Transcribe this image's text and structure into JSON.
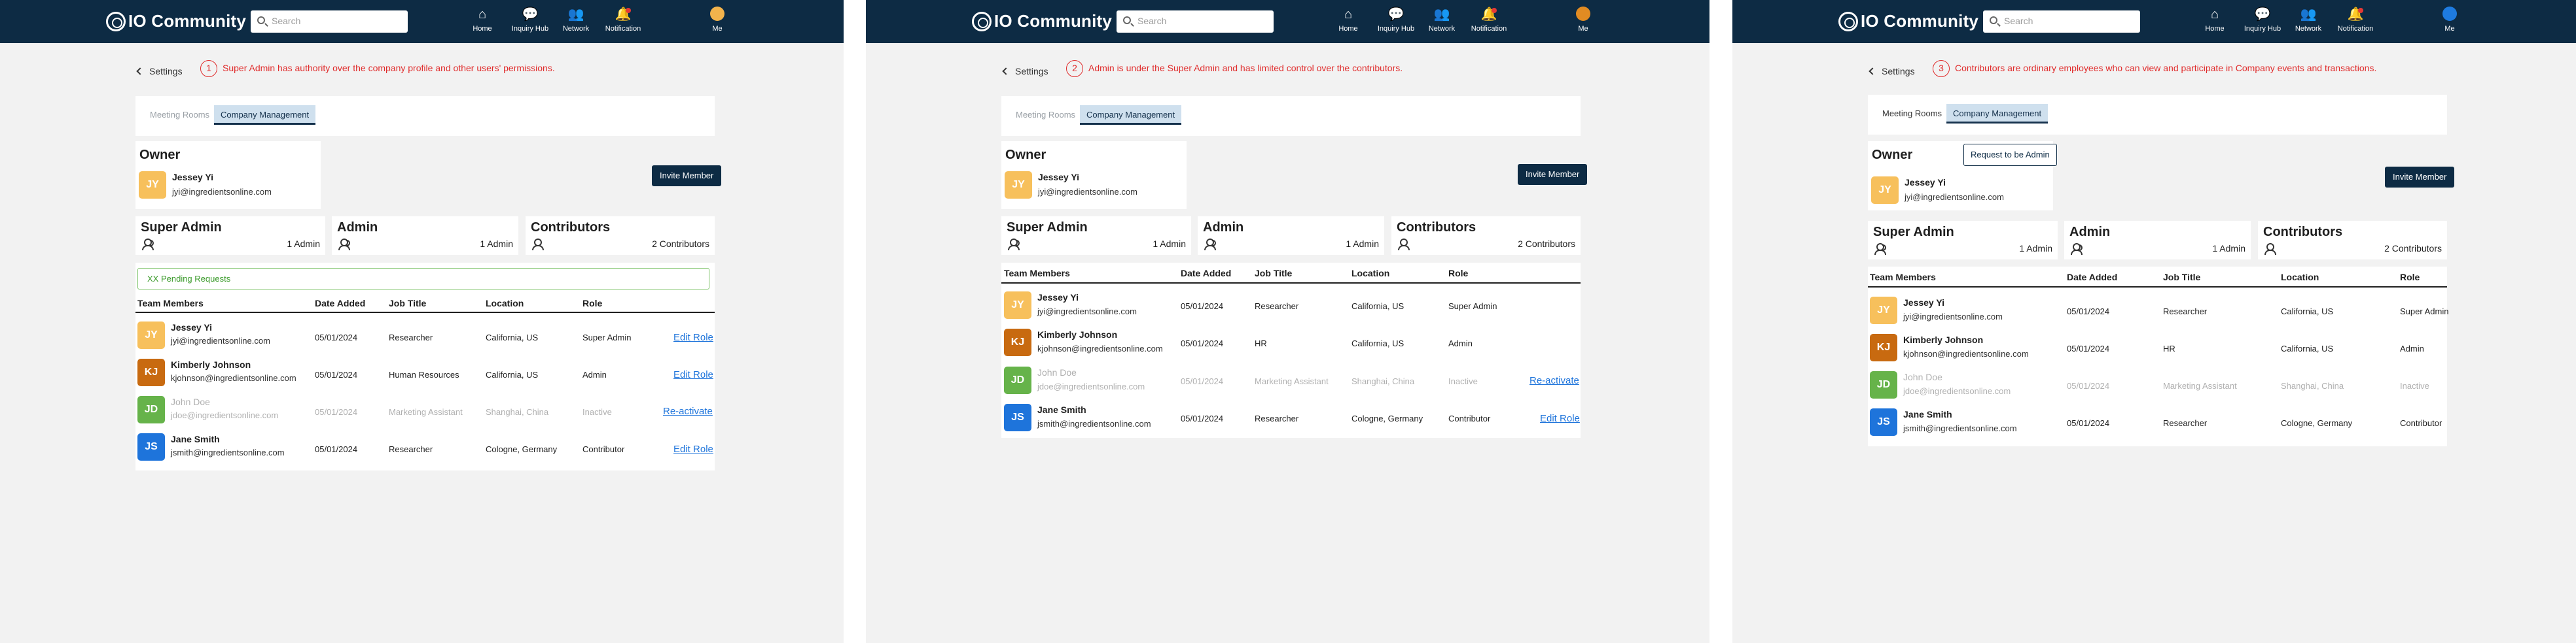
{
  "header": {
    "brand": "IO Community",
    "search_placeholder": "Search",
    "nav": [
      {
        "label": "Home",
        "glyph": "⌂"
      },
      {
        "label": "Inquiry Hub",
        "glyph": "💬"
      },
      {
        "label": "Network",
        "glyph": "👥"
      },
      {
        "label": "Notification",
        "glyph": "🔔"
      },
      {
        "label": "Me",
        "glyph": ""
      }
    ]
  },
  "colors": {
    "topbar": "#0d2b44",
    "accent_red": "#e02b2b",
    "link": "#1e74db",
    "pending_green": "#7ec46a"
  },
  "back_label": "Settings",
  "tabs": [
    "Meeting Rooms",
    "Company Management"
  ],
  "owner": {
    "title": "Owner",
    "initials": "JY",
    "name": "Jessey Yi",
    "email": "jyi@ingredientsonline.com"
  },
  "invite_label": "Invite Member",
  "request_admin_label": "Request to be Admin",
  "stats": [
    {
      "title": "Super Admin",
      "count": "1 Admin"
    },
    {
      "title": "Admin",
      "count": "1 Admin"
    },
    {
      "title": "Contributors",
      "count": "2 Contributors"
    }
  ],
  "pending_label": "XX Pending Requests",
  "table": {
    "headers": [
      "Team Members",
      "Date Added",
      "Job Title",
      "Location",
      "Role"
    ],
    "rows": [
      {
        "initials": "JY",
        "name": "Jessey Yi",
        "email": "jyi@ingredientsonline.com",
        "date": "05/01/2024",
        "job": "Researcher",
        "location": "California, US",
        "role": "Super Admin"
      },
      {
        "initials": "KJ",
        "name": "Kimberly Johnson",
        "email": "kjohnson@ingredientsonline.com",
        "date": "05/01/2024",
        "job_p1": "Human Resources",
        "job": "HR",
        "location": "California, US",
        "role": "Admin"
      },
      {
        "initials": "JD",
        "name": "John Doe",
        "email": "jdoe@ingredientsonline.com",
        "date": "05/01/2024",
        "job": "Marketing Assistant",
        "location": "Shanghai, China",
        "role": "Inactive"
      },
      {
        "initials": "JS",
        "name": "Jane Smith",
        "email": "jsmith@ingredientsonline.com",
        "date": "05/01/2024",
        "job": "Researcher",
        "location": "Cologne, Germany",
        "role": "Contributor"
      }
    ],
    "edit_label": "Edit Role",
    "reactivate_label": "Re-activate"
  },
  "panels": [
    {
      "number": "1",
      "note": "Super Admin has authority over the company profile and other users' permissions."
    },
    {
      "number": "2",
      "note": "Admin is under the Super Admin and has limited control over the contributors."
    },
    {
      "number": "3",
      "note": "Contributors are ordinary employees who can view and participate in Company events and transactions."
    }
  ]
}
